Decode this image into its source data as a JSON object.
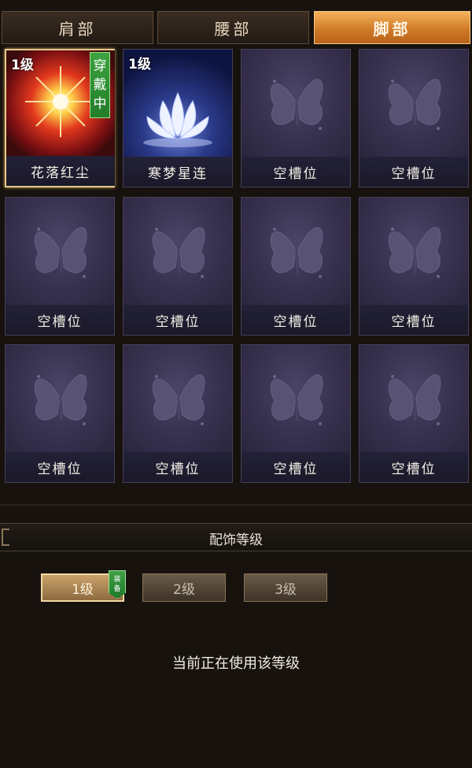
{
  "tabs": [
    {
      "label": "肩部",
      "active": false
    },
    {
      "label": "腰部",
      "active": false
    },
    {
      "label": "脚部",
      "active": true
    }
  ],
  "slots": [
    {
      "name": "花落红尘",
      "level": "1级",
      "worn": "穿戴中",
      "type": "sun",
      "selected": true
    },
    {
      "name": "寒梦星连",
      "level": "1级",
      "worn": "",
      "type": "lotus",
      "selected": false
    },
    {
      "name": "空槽位",
      "type": "empty"
    },
    {
      "name": "空槽位",
      "type": "empty"
    },
    {
      "name": "空槽位",
      "type": "empty"
    },
    {
      "name": "空槽位",
      "type": "empty"
    },
    {
      "name": "空槽位",
      "type": "empty"
    },
    {
      "name": "空槽位",
      "type": "empty"
    },
    {
      "name": "空槽位",
      "type": "empty"
    },
    {
      "name": "空槽位",
      "type": "empty"
    },
    {
      "name": "空槽位",
      "type": "empty"
    },
    {
      "name": "空槽位",
      "type": "empty"
    }
  ],
  "section": {
    "title": "配饰等级"
  },
  "levels": [
    {
      "label": "1级",
      "active": true
    },
    {
      "label": "2级",
      "active": false
    },
    {
      "label": "3级",
      "active": false
    }
  ],
  "equip_badge": "装备",
  "status_text": "当前正在使用该等级",
  "colors": {
    "active_tab": "#d07b26",
    "worn_badge": "#2e8f35",
    "card_bg": "#37314f"
  }
}
